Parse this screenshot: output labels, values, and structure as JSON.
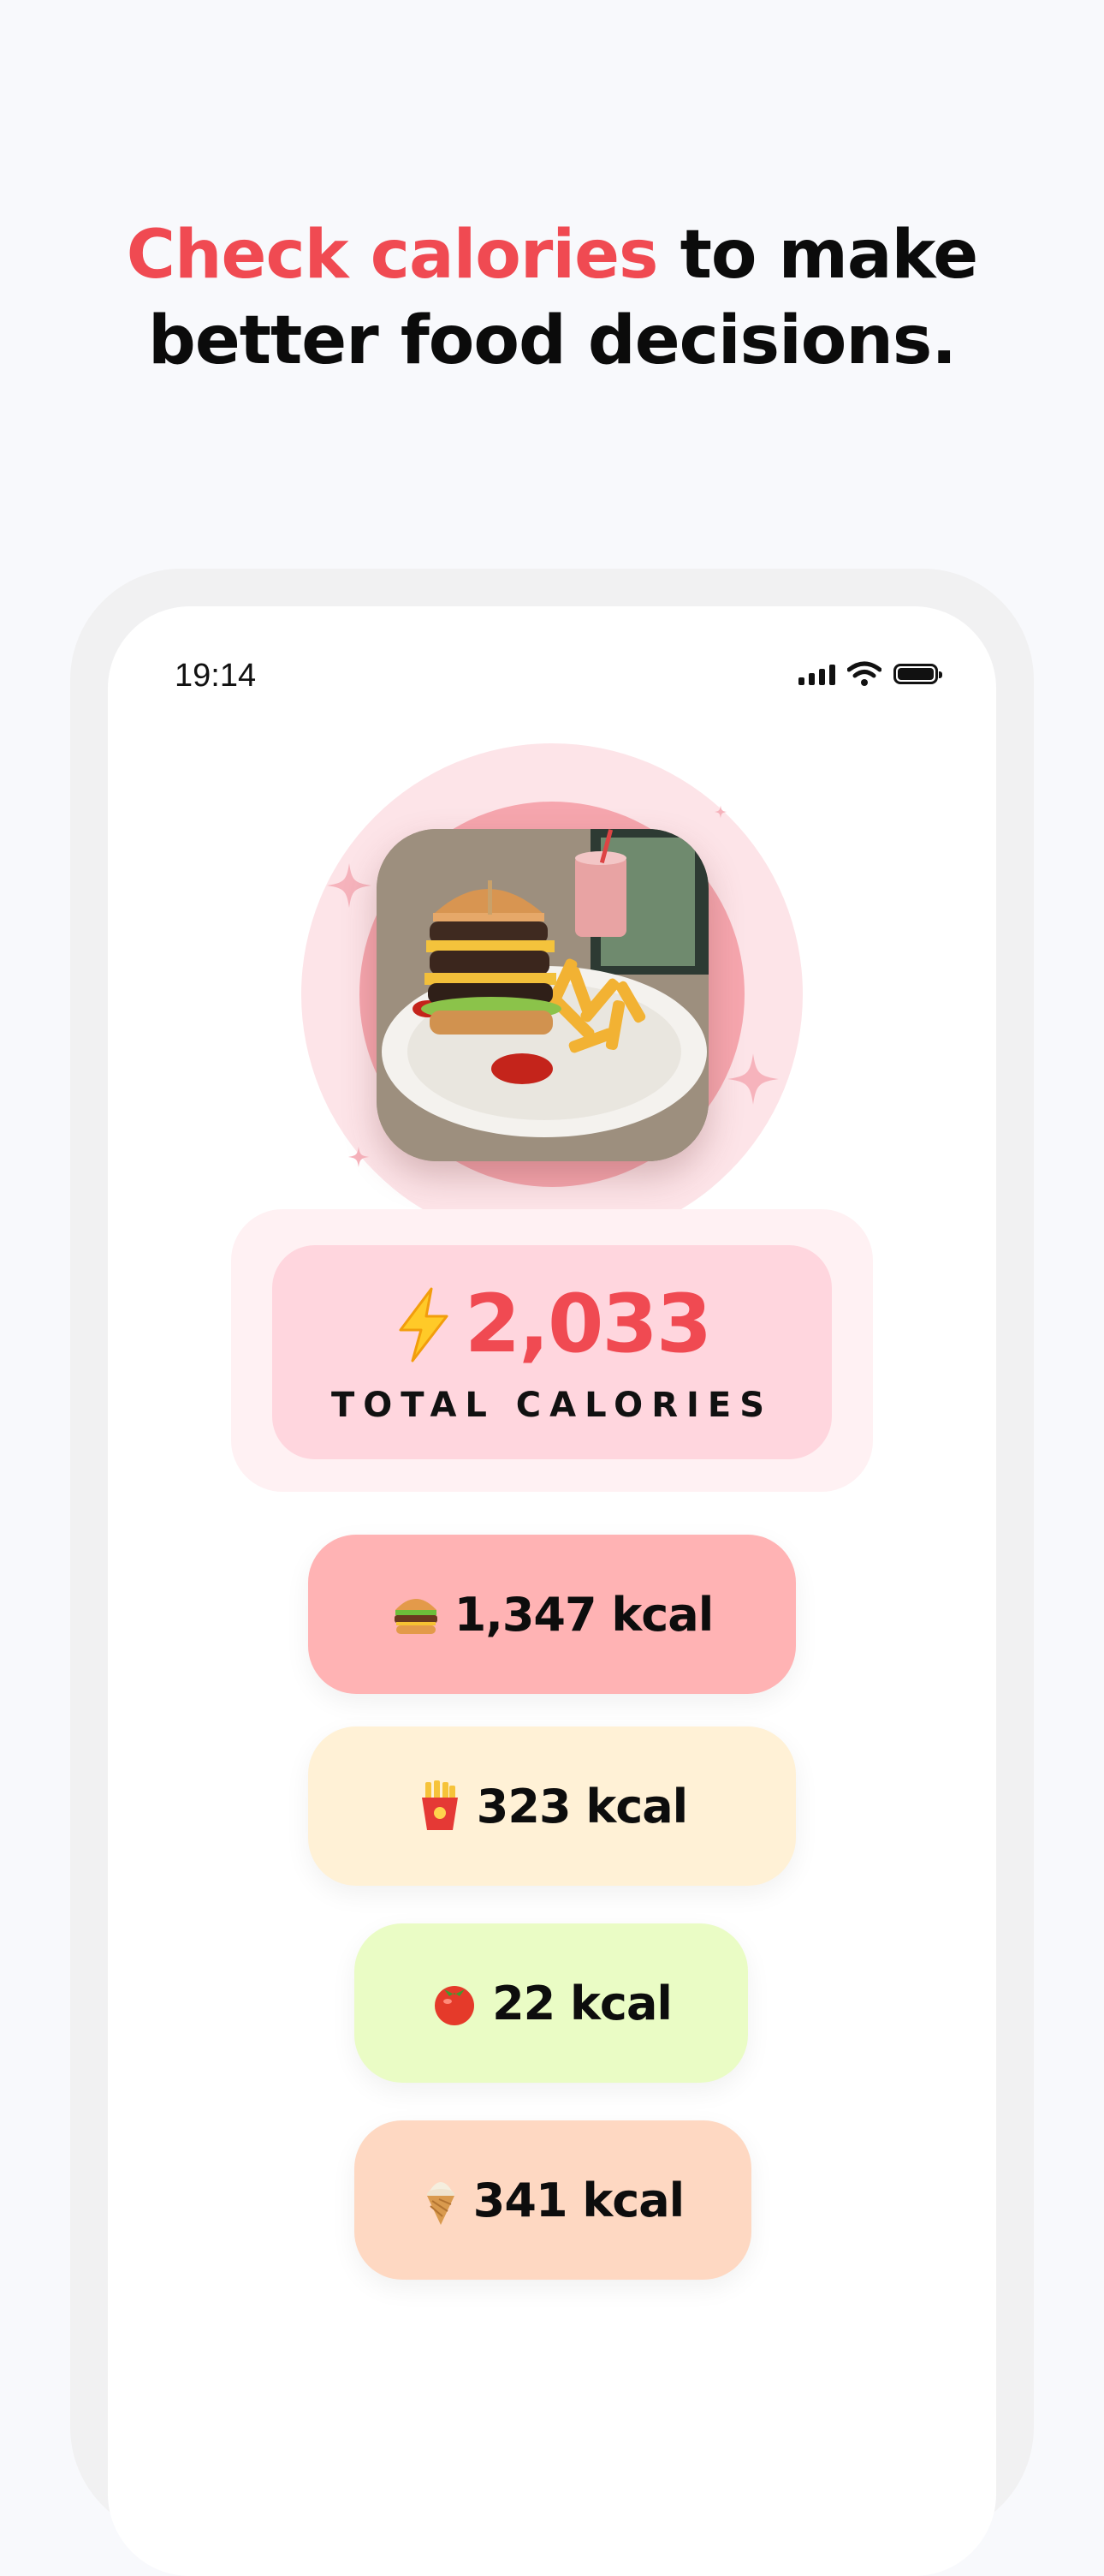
{
  "headline": {
    "accent": "Check calories",
    "rest_line1": " to make",
    "line2": "better food decisions."
  },
  "status_bar": {
    "time": "19:14"
  },
  "total": {
    "value": "2,033",
    "label": "TOTAL CALORIES"
  },
  "items": [
    {
      "icon": "burger-icon",
      "label": "1,347 kcal",
      "color": "#ffb3b4"
    },
    {
      "icon": "fries-icon",
      "label": "323 kcal",
      "color": "#fff1d6"
    },
    {
      "icon": "tomato-icon",
      "label": "22 kcal",
      "color": "#eafcc5"
    },
    {
      "icon": "ice-cream-icon",
      "label": "341 kcal",
      "color": "#fed8c2"
    }
  ],
  "colors": {
    "accent": "#f04a52",
    "background": "#f8f9fc",
    "total_card": "#ffd6de"
  }
}
